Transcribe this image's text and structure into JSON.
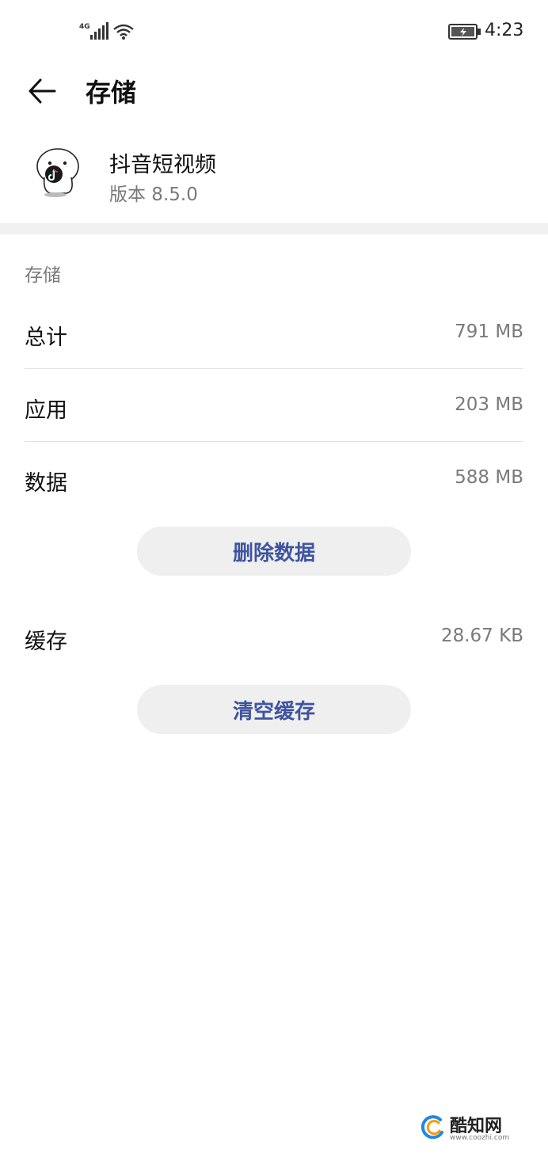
{
  "status_bar": {
    "network": "4G",
    "time": "4:23"
  },
  "header": {
    "title": "存储"
  },
  "app": {
    "name": "抖音短视频",
    "version": "版本 8.5.0"
  },
  "storage": {
    "section_title": "存储",
    "rows": [
      {
        "label": "总计",
        "value": "791 MB"
      },
      {
        "label": "应用",
        "value": "203 MB"
      },
      {
        "label": "数据",
        "value": "588 MB"
      }
    ],
    "delete_data_label": "删除数据",
    "cache": {
      "label": "缓存",
      "value": "28.67 KB"
    },
    "clear_cache_label": "清空缓存"
  },
  "watermark": {
    "brand": "酷知网",
    "url": "www.coozhi.com"
  },
  "colors": {
    "accent": "#3f54a0",
    "secondary_text": "#7a7a7a",
    "button_bg": "#efefef"
  }
}
